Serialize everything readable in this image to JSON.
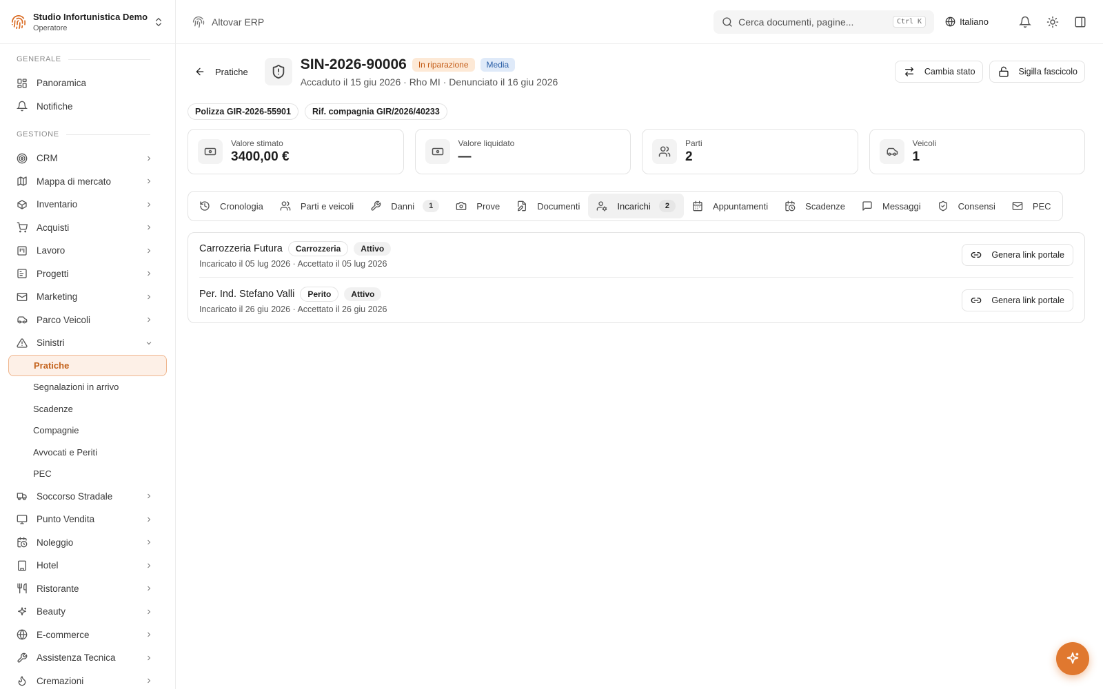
{
  "org": {
    "name": "Studio Infortunistica Demo",
    "role": "Operatore"
  },
  "sidebar": {
    "section_general": "GENERALE",
    "general_items": [
      {
        "label": "Panoramica",
        "icon": "dashboard-icon"
      },
      {
        "label": "Notifiche",
        "icon": "bell-icon"
      }
    ],
    "section_management": "GESTIONE",
    "management_items": [
      {
        "label": "CRM",
        "icon": "target-icon"
      },
      {
        "label": "Mappa di mercato",
        "icon": "map-icon"
      },
      {
        "label": "Inventario",
        "icon": "box-icon"
      },
      {
        "label": "Acquisti",
        "icon": "cart-icon"
      },
      {
        "label": "Lavoro",
        "icon": "kanban-icon"
      },
      {
        "label": "Progetti",
        "icon": "chart-icon"
      },
      {
        "label": "Marketing",
        "icon": "mail-icon"
      },
      {
        "label": "Parco Veicoli",
        "icon": "car-icon"
      },
      {
        "label": "Sinistri",
        "icon": "warning-icon"
      }
    ],
    "sinistri_sub": [
      {
        "label": "Pratiche"
      },
      {
        "label": "Segnalazioni in arrivo"
      },
      {
        "label": "Scadenze"
      },
      {
        "label": "Compagnie"
      },
      {
        "label": "Avvocati e Periti"
      },
      {
        "label": "PEC"
      }
    ],
    "more_items": [
      {
        "label": "Soccorso Stradale",
        "icon": "truck-icon"
      },
      {
        "label": "Punto Vendita",
        "icon": "monitor-icon"
      },
      {
        "label": "Noleggio",
        "icon": "calendar-clock-icon"
      },
      {
        "label": "Hotel",
        "icon": "building-icon"
      },
      {
        "label": "Ristorante",
        "icon": "utensils-icon"
      },
      {
        "label": "Beauty",
        "icon": "sparkles-icon"
      },
      {
        "label": "E-commerce",
        "icon": "globe-icon"
      },
      {
        "label": "Assistenza Tecnica",
        "icon": "wrench-icon"
      },
      {
        "label": "Cremazioni",
        "icon": "flame-icon"
      }
    ]
  },
  "topbar": {
    "app_title": "Altovar ERP",
    "search_placeholder": "Cerca documenti, pagine...",
    "search_shortcut": "Ctrl K",
    "language": "Italiano"
  },
  "case": {
    "back_label": "Pratiche",
    "id": "SIN-2026-90006",
    "status": "In riparazione",
    "priority": "Media",
    "subtitle": "Accaduto il 15 giu 2026 · Rho MI · Denunciato il 16 giu 2026",
    "btn_change_state": "Cambia stato",
    "btn_seal": "Sigilla fascicolo",
    "chips": [
      "Polizza GIR-2026-55901",
      "Rif. compagnia GIR/2026/40233"
    ]
  },
  "stats": [
    {
      "label": "Valore stimato",
      "value": "3400,00 €",
      "icon": "banknote-icon"
    },
    {
      "label": "Valore liquidato",
      "value": "—",
      "icon": "banknote-icon"
    },
    {
      "label": "Parti",
      "value": "2",
      "icon": "users-icon"
    },
    {
      "label": "Veicoli",
      "value": "1",
      "icon": "car-icon"
    }
  ],
  "tabs": [
    {
      "label": "Cronologia",
      "icon": "history-icon"
    },
    {
      "label": "Parti e veicoli",
      "icon": "users-icon"
    },
    {
      "label": "Danni",
      "icon": "wrench-icon",
      "count": "1"
    },
    {
      "label": "Prove",
      "icon": "camera-icon"
    },
    {
      "label": "Documenti",
      "icon": "file-edit-icon"
    },
    {
      "label": "Incarichi",
      "icon": "user-cog-icon",
      "count": "2",
      "active": true
    },
    {
      "label": "Appuntamenti",
      "icon": "calendar-icon"
    },
    {
      "label": "Scadenze",
      "icon": "calendar-clock-icon"
    },
    {
      "label": "Messaggi",
      "icon": "message-icon"
    },
    {
      "label": "Consensi",
      "icon": "shield-check-icon"
    },
    {
      "label": "PEC",
      "icon": "mail-icon"
    }
  ],
  "assignments": [
    {
      "name": "Carrozzeria Futura",
      "role": "Carrozzeria",
      "status": "Attivo",
      "meta": "Incaricato il 05 lug 2026 · Accettato il 05 lug 2026",
      "action": "Genera link portale"
    },
    {
      "name": "Per. Ind. Stefano Valli",
      "role": "Perito",
      "status": "Attivo",
      "meta": "Incaricato il 26 giu 2026 · Accettato il 26 giu 2026",
      "action": "Genera link portale"
    }
  ],
  "colors": {
    "accent": "#e0782f",
    "status_bg": "#fde9d6",
    "priority_bg": "#dfeaf9"
  }
}
